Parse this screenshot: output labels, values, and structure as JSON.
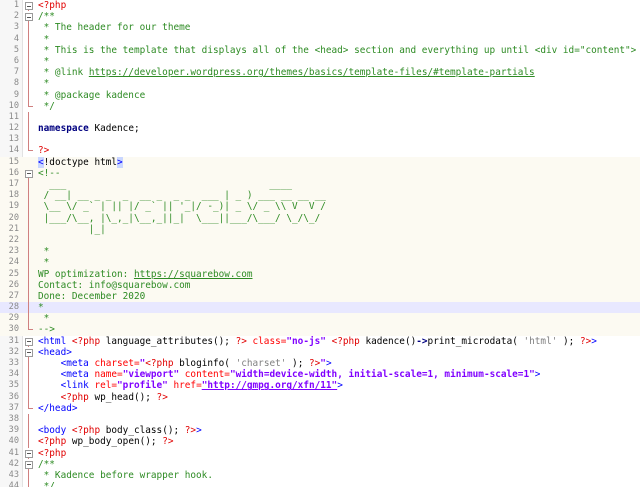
{
  "editor": {
    "lines": [
      {
        "n": "1",
        "fold": "box",
        "tokens": [
          [
            "php",
            "<?php"
          ]
        ]
      },
      {
        "n": "2",
        "fold": "box",
        "tokens": [
          [
            "comment",
            "/**"
          ]
        ]
      },
      {
        "n": "3",
        "fold": "v",
        "tokens": [
          [
            "comment",
            " * The header for our theme"
          ]
        ]
      },
      {
        "n": "4",
        "fold": "v",
        "tokens": [
          [
            "comment",
            " *"
          ]
        ]
      },
      {
        "n": "5",
        "fold": "v",
        "tokens": [
          [
            "comment",
            " * This is the template that displays all of the <head> section and everything up until <div id=\"content\">"
          ]
        ]
      },
      {
        "n": "6",
        "fold": "v",
        "tokens": [
          [
            "comment",
            " *"
          ]
        ]
      },
      {
        "n": "7",
        "fold": "v",
        "tokens": [
          [
            "comment",
            " * @link "
          ],
          [
            "link",
            "https://developer.wordpress.org/themes/basics/template-files/#template-partials"
          ]
        ]
      },
      {
        "n": "8",
        "fold": "v",
        "tokens": [
          [
            "comment",
            " *"
          ]
        ]
      },
      {
        "n": "9",
        "fold": "v",
        "tokens": [
          [
            "comment",
            " * @package kadence"
          ]
        ]
      },
      {
        "n": "10",
        "fold": "end",
        "tokens": [
          [
            "comment",
            " */"
          ]
        ]
      },
      {
        "n": "11",
        "fold": "v",
        "tokens": []
      },
      {
        "n": "12",
        "fold": "v",
        "tokens": [
          [
            "kw",
            "namespace"
          ],
          [
            "plain",
            " Kadence;"
          ]
        ]
      },
      {
        "n": "13",
        "fold": "v",
        "tokens": []
      },
      {
        "n": "14",
        "fold": "end",
        "tokens": [
          [
            "php",
            "?>"
          ]
        ]
      },
      {
        "n": "15",
        "fold": "",
        "zone": true,
        "tokens": [
          [
            "dtbr",
            "<"
          ],
          [
            "doctype",
            "!doctype html"
          ],
          [
            "dtbr",
            ">"
          ]
        ]
      },
      {
        "n": "16",
        "fold": "box",
        "zone": true,
        "tokens": [
          [
            "comment",
            "<!--"
          ]
        ]
      },
      {
        "n": "17",
        "fold": "v",
        "zone": true,
        "tokens": [
          [
            "comment",
            "  ___                                    ____"
          ]
        ]
      },
      {
        "n": "18",
        "fold": "v",
        "zone": true,
        "tokens": [
          [
            "comment",
            " / __| __ _ _  _  __ _  _ _  ___ | _ ) ___ __ __ __"
          ]
        ]
      },
      {
        "n": "19",
        "fold": "v",
        "zone": true,
        "tokens": [
          [
            "comment",
            " \\__ \\/ _` | || |/ _` || '_|/ -_)| _ \\/ _ \\\\ V  V /"
          ]
        ]
      },
      {
        "n": "20",
        "fold": "v",
        "zone": true,
        "tokens": [
          [
            "comment",
            " |___/\\__, |\\_,_|\\__,_||_|  \\___||___/\\___/ \\_/\\_/"
          ]
        ]
      },
      {
        "n": "21",
        "fold": "v",
        "zone": true,
        "tokens": [
          [
            "comment",
            "         |_|"
          ]
        ]
      },
      {
        "n": "22",
        "fold": "v",
        "zone": true,
        "tokens": []
      },
      {
        "n": "23",
        "fold": "v",
        "zone": true,
        "tokens": [
          [
            "comment",
            " *"
          ]
        ]
      },
      {
        "n": "24",
        "fold": "v",
        "zone": true,
        "tokens": [
          [
            "comment",
            " *"
          ]
        ]
      },
      {
        "n": "25",
        "fold": "v",
        "zone": true,
        "tokens": [
          [
            "comment",
            "WP optimization: "
          ],
          [
            "link",
            "https://squarebow.com"
          ]
        ]
      },
      {
        "n": "26",
        "fold": "v",
        "zone": true,
        "tokens": [
          [
            "comment",
            "Contact: info@squarebow.com"
          ]
        ]
      },
      {
        "n": "27",
        "fold": "v",
        "zone": true,
        "tokens": [
          [
            "comment",
            "Done: December 2020"
          ]
        ]
      },
      {
        "n": "28",
        "fold": "v",
        "current": true,
        "tokens": [
          [
            "comment",
            "*"
          ]
        ]
      },
      {
        "n": "29",
        "fold": "v",
        "zone": true,
        "tokens": [
          [
            "comment",
            " *"
          ]
        ]
      },
      {
        "n": "30",
        "fold": "end",
        "zone": true,
        "tokens": [
          [
            "comment",
            "-->"
          ]
        ]
      },
      {
        "n": "31",
        "fold": "box",
        "tokens": [
          [
            "tag",
            "<html "
          ],
          [
            "php",
            "<?php"
          ],
          [
            "fn",
            " language_attributes(); "
          ],
          [
            "php",
            "?>"
          ],
          [
            "attr",
            " class="
          ],
          [
            "val",
            "\"no-js\""
          ],
          [
            "tag",
            " "
          ],
          [
            "php",
            "<?php"
          ],
          [
            "fn",
            " kadence()"
          ],
          [
            "arrow",
            "->"
          ],
          [
            "fn",
            "print_microdata( "
          ],
          [
            "str",
            "'html'"
          ],
          [
            "fn",
            " ); "
          ],
          [
            "php",
            "?>"
          ],
          [
            "tag",
            ">"
          ]
        ]
      },
      {
        "n": "32",
        "fold": "box",
        "tokens": [
          [
            "tag",
            "<head>"
          ]
        ]
      },
      {
        "n": "33",
        "fold": "v",
        "tokens": [
          [
            "plain",
            "    "
          ],
          [
            "tag",
            "<meta "
          ],
          [
            "attr",
            "charset="
          ],
          [
            "val",
            "\""
          ],
          [
            "php",
            "<?php"
          ],
          [
            "fn",
            " bloginfo( "
          ],
          [
            "str",
            "'charset'"
          ],
          [
            "fn",
            " ); "
          ],
          [
            "php",
            "?>"
          ],
          [
            "val",
            "\""
          ],
          [
            "tag",
            ">"
          ]
        ]
      },
      {
        "n": "34",
        "fold": "v",
        "tokens": [
          [
            "plain",
            "    "
          ],
          [
            "tag",
            "<meta "
          ],
          [
            "attr",
            "name="
          ],
          [
            "val",
            "\"viewport\""
          ],
          [
            "attr",
            " content="
          ],
          [
            "val",
            "\"width=device-width, initial-scale=1, minimum-scale=1\""
          ],
          [
            "tag",
            ">"
          ]
        ]
      },
      {
        "n": "35",
        "fold": "v",
        "tokens": [
          [
            "plain",
            "    "
          ],
          [
            "tag",
            "<link "
          ],
          [
            "attr",
            "rel="
          ],
          [
            "val",
            "\"profile\""
          ],
          [
            "attr",
            " href="
          ],
          [
            "val-u",
            "\"http://gmpg.org/xfn/11\""
          ],
          [
            "tag",
            ">"
          ]
        ]
      },
      {
        "n": "36",
        "fold": "v",
        "tokens": [
          [
            "plain",
            "    "
          ],
          [
            "php",
            "<?php"
          ],
          [
            "fn",
            " wp_head(); "
          ],
          [
            "php",
            "?>"
          ]
        ]
      },
      {
        "n": "37",
        "fold": "end",
        "tokens": [
          [
            "tag",
            "</head>"
          ]
        ]
      },
      {
        "n": "38",
        "fold": "v",
        "tokens": []
      },
      {
        "n": "39",
        "fold": "v",
        "tokens": [
          [
            "tag",
            "<body "
          ],
          [
            "php",
            "<?php"
          ],
          [
            "fn",
            " body_class(); "
          ],
          [
            "php",
            "?>"
          ],
          [
            "tag",
            ">"
          ]
        ]
      },
      {
        "n": "40",
        "fold": "v",
        "tokens": [
          [
            "php",
            "<?php"
          ],
          [
            "fn",
            " wp_body_open(); "
          ],
          [
            "php",
            "?>"
          ]
        ]
      },
      {
        "n": "41",
        "fold": "box",
        "tokens": [
          [
            "php",
            "<?php"
          ]
        ]
      },
      {
        "n": "42",
        "fold": "box",
        "tokens": [
          [
            "comment",
            "/**"
          ]
        ]
      },
      {
        "n": "43",
        "fold": "v",
        "tokens": [
          [
            "comment",
            " * Kadence before wrapper hook."
          ]
        ]
      },
      {
        "n": "44",
        "fold": "v",
        "tokens": [
          [
            "comment",
            " */"
          ]
        ]
      }
    ]
  },
  "colors": {
    "comment": "#2e8b24",
    "php": "#e00000",
    "tag": "#0000ff",
    "attr": "#ff0000",
    "value": "#8000ff",
    "keyword": "#000080"
  }
}
